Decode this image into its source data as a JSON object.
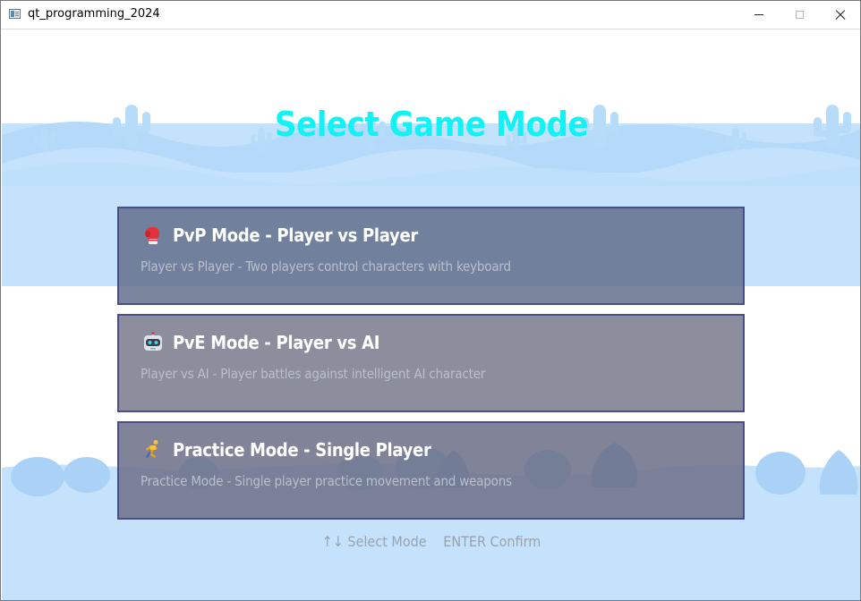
{
  "window": {
    "title": "qt_programming_2024"
  },
  "icons": {
    "app": "app-window-icon",
    "minimize": "minimize-icon",
    "maximize": "maximize-icon",
    "close": "close-icon",
    "pvp": "boxing-glove-icon",
    "pve": "robot-icon",
    "practice": "running-person-icon"
  },
  "colors": {
    "heading": "#11f2f5",
    "sky": "#c4e2fb",
    "hills": "#a9d2f6",
    "cactus": "#b6dcfa",
    "card_border": "#4a4d8a",
    "card_text": "#ffffff",
    "card_desc": "#b9bfcc"
  },
  "menu": {
    "heading": "Select Game Mode",
    "options": [
      {
        "title": "PvP Mode - Player vs Player",
        "description": "Player vs Player - Two players control characters with keyboard"
      },
      {
        "title": "PvE Mode - Player vs AI",
        "description": "Player vs AI - Player battles against intelligent AI character"
      },
      {
        "title": "Practice Mode - Single Player",
        "description": "Practice Mode - Single player practice movement and weapons"
      }
    ]
  },
  "hint": {
    "select": "↑↓ Select Mode",
    "confirm": "ENTER Confirm"
  }
}
